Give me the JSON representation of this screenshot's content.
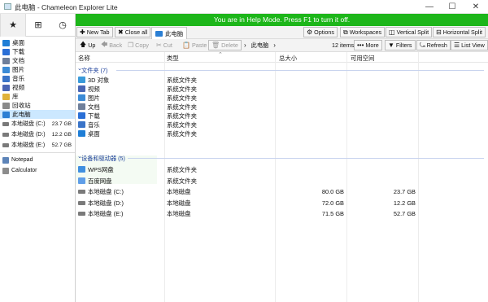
{
  "window": {
    "title": "此电脑 - Chameleon Explorer Lite",
    "minimize": "—",
    "maximize": "☐",
    "close": "✕"
  },
  "helpbar": {
    "text": "You are in Help Mode. Press F1 to turn it off."
  },
  "left_pane": {
    "top_buttons": [
      "★",
      "⊞",
      "◷"
    ],
    "tree": [
      {
        "label": "桌面",
        "icon": "desktop-icon",
        "color": "#1f7ed6"
      },
      {
        "label": "下载",
        "icon": "download-icon",
        "color": "#2a6fd6"
      },
      {
        "label": "文档",
        "icon": "document-icon",
        "color": "#6f7f9a"
      },
      {
        "label": "图片",
        "icon": "picture-icon",
        "color": "#3c8bd6"
      },
      {
        "label": "音乐",
        "icon": "music-icon",
        "color": "#3a74c8"
      },
      {
        "label": "视频",
        "icon": "video-icon",
        "color": "#4a66b4"
      },
      {
        "label": "库",
        "icon": "library-icon",
        "color": "#e0b23a"
      },
      {
        "label": "回收站",
        "icon": "recycle-bin-icon",
        "color": "#8a8a8a"
      },
      {
        "label": "此电脑",
        "icon": "computer-icon",
        "color": "#2b7fd4"
      }
    ],
    "drives": [
      {
        "label": "本地磁盘 (C:)",
        "size": "23.7 GB"
      },
      {
        "label": "本地磁盘 (D:)",
        "size": "12.2 GB"
      },
      {
        "label": "本地磁盘 (E:)",
        "size": "52.7 GB"
      }
    ],
    "apps": [
      {
        "label": "Notepad",
        "icon": "notepad-icon"
      },
      {
        "label": "Calculator",
        "icon": "calculator-icon"
      }
    ]
  },
  "toolbar1": {
    "new_tab": "New Tab",
    "close_all": "Close all",
    "active_tab": "此电脑",
    "options": "Options",
    "workspaces": "Workspaces",
    "vertical_split": "Vertical Split",
    "horizontal_split": "Horizontal Split"
  },
  "toolbar2": {
    "up": "Up",
    "back": "Back",
    "copy": "Copy",
    "cut": "Cut",
    "paste": "Paste",
    "delete": "Delete",
    "path": "此电脑",
    "item_count": "12 items",
    "more": "More",
    "filters": "Filters",
    "refresh": "Refresh",
    "list_view": "List View"
  },
  "columns": {
    "name": "名称",
    "type": "类型",
    "total_size": "总大小",
    "free_space": "可用空间"
  },
  "groups": [
    {
      "header": "文件夹 (7)"
    },
    {
      "header": "设备和驱动器 (5)"
    }
  ],
  "folders": [
    {
      "name": "3D 对象",
      "type": "系统文件夹",
      "icon": "3d-objects-icon",
      "color": "#3a9ad9"
    },
    {
      "name": "视频",
      "type": "系统文件夹",
      "icon": "video-icon",
      "color": "#4a66b4"
    },
    {
      "name": "图片",
      "type": "系统文件夹",
      "icon": "picture-icon",
      "color": "#3c8bd6"
    },
    {
      "name": "文档",
      "type": "系统文件夹",
      "icon": "document-icon",
      "color": "#6f7f9a"
    },
    {
      "name": "下载",
      "type": "系统文件夹",
      "icon": "download-icon",
      "color": "#2a6fd6"
    },
    {
      "name": "音乐",
      "type": "系统文件夹",
      "icon": "music-icon",
      "color": "#3a74c8"
    },
    {
      "name": "桌面",
      "type": "系统文件夹",
      "icon": "desktop-icon",
      "color": "#1f7ed6"
    }
  ],
  "devices": [
    {
      "name": "WPS网盘",
      "type": "系统文件夹",
      "total": "",
      "free": "",
      "icon": "cloud-icon",
      "color": "#3f8fe0"
    },
    {
      "name": "百度网盘",
      "type": "系统文件夹",
      "total": "",
      "free": "",
      "icon": "cloud-disk-icon",
      "color": "#5f9ee8"
    },
    {
      "name": "本地磁盘 (C:)",
      "type": "本地磁盘",
      "total": "80.0 GB",
      "free": "23.7 GB",
      "icon": "drive-icon",
      "color": "#7a7a7a"
    },
    {
      "name": "本地磁盘 (D:)",
      "type": "本地磁盘",
      "total": "72.0 GB",
      "free": "12.2 GB",
      "icon": "drive-icon",
      "color": "#7a7a7a"
    },
    {
      "name": "本地磁盘 (E:)",
      "type": "本地磁盘",
      "total": "71.5 GB",
      "free": "52.7 GB",
      "icon": "drive-icon",
      "color": "#7a7a7a"
    }
  ]
}
